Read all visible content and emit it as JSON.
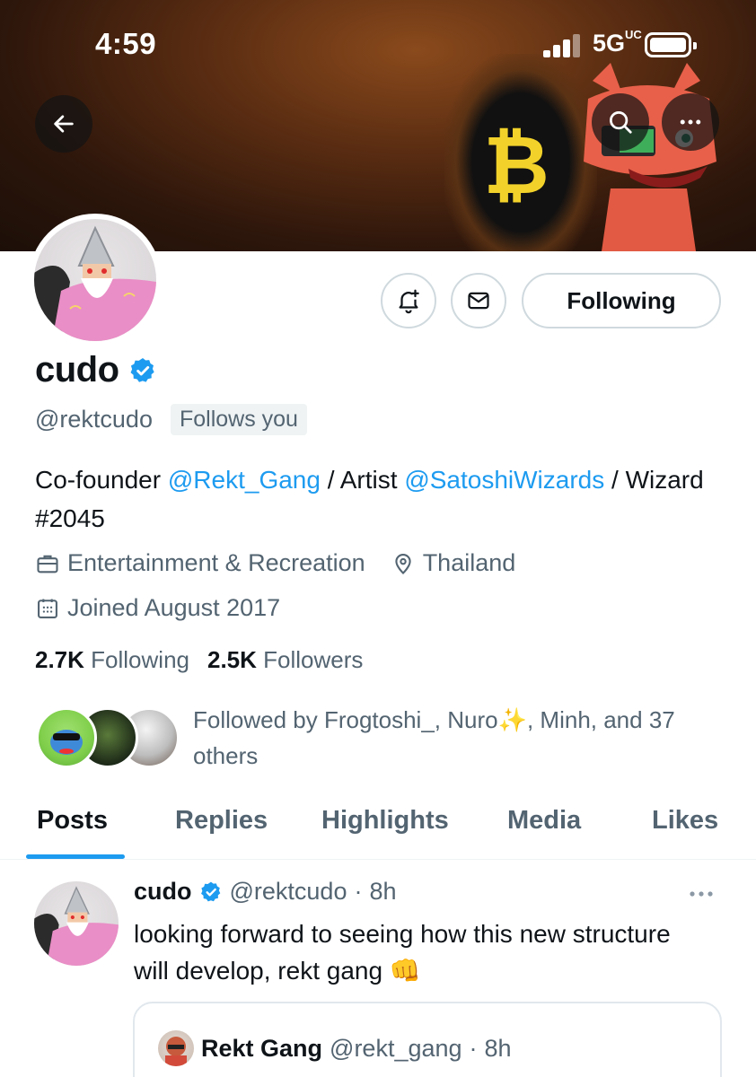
{
  "status_bar": {
    "time": "4:59",
    "network": "5G",
    "network_suffix": "UC"
  },
  "profile": {
    "display_name": "cudo",
    "handle": "@rektcudo",
    "follows_you_label": "Follows you",
    "bio": {
      "part1": "Co-founder ",
      "mention1": "@Rekt_Gang",
      "part2": " / Artist ",
      "mention2": "@SatoshiWizards",
      "part3": " / Wizard #2045"
    },
    "category": "Entertainment & Recreation",
    "location": "Thailand",
    "joined": "Joined August 2017",
    "following_count": "2.7K",
    "following_label": "Following",
    "followers_count": "2.5K",
    "followers_label": "Followers",
    "followed_by_text": "Followed by Frogtoshi_, Nuro✨, Minh, and 37 others"
  },
  "actions": {
    "following_button": "Following"
  },
  "tabs": [
    {
      "label": "Posts",
      "active": true
    },
    {
      "label": "Replies",
      "active": false
    },
    {
      "label": "Highlights",
      "active": false
    },
    {
      "label": "Media",
      "active": false
    },
    {
      "label": "Likes",
      "active": false
    }
  ],
  "post": {
    "name": "cudo",
    "handle": "@rektcudo",
    "time": "8h",
    "text": "looking forward to seeing how this new structure will develop, rekt gang 👊",
    "quote": {
      "name": "Rekt Gang",
      "handle": "@rekt_gang",
      "time": "8h"
    }
  },
  "colors": {
    "accent": "#1d9bf0",
    "secondary_text": "#536471",
    "primary_text": "#0f1419"
  },
  "icons": [
    "back-arrow-icon",
    "search-icon",
    "more-icon",
    "notification-bell-icon",
    "message-icon",
    "verified-badge-icon",
    "briefcase-icon",
    "location-pin-icon",
    "calendar-icon"
  ]
}
